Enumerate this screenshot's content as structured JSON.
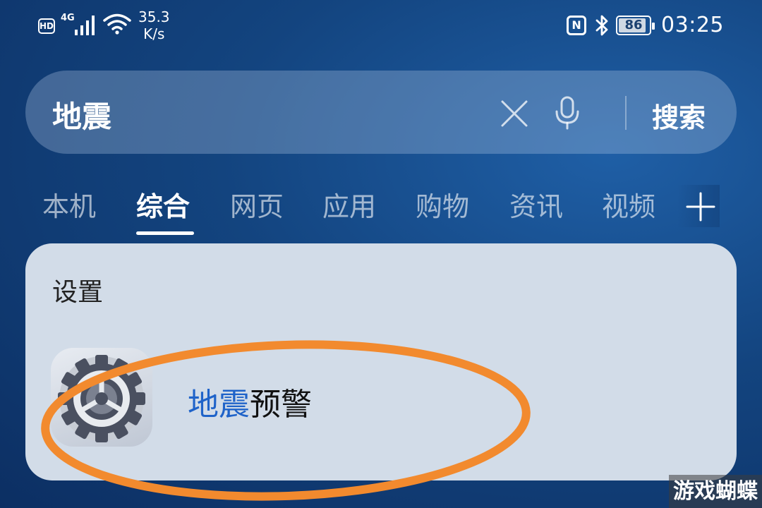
{
  "status_bar": {
    "hd_badge": "HD",
    "network": "4G",
    "net_speed_value": "35.3",
    "net_speed_unit": "K/s",
    "nfc_badge": "N",
    "battery_level": "86",
    "time": "03:25"
  },
  "search": {
    "query": "地震",
    "button_label": "搜索",
    "icons": [
      "close-icon",
      "microphone-icon"
    ]
  },
  "tabs": [
    {
      "label": "本机",
      "active": false
    },
    {
      "label": "综合",
      "active": true
    },
    {
      "label": "网页",
      "active": false
    },
    {
      "label": "应用",
      "active": false
    },
    {
      "label": "购物",
      "active": false
    },
    {
      "label": "资讯",
      "active": false
    },
    {
      "label": "视频",
      "active": false
    }
  ],
  "result_card": {
    "section_title": "设置",
    "item": {
      "highlight": "地震",
      "rest": "预警",
      "icon": "settings-gear-icon"
    }
  },
  "colors": {
    "highlight": "#1f63c9",
    "annotation_ring": "#f28a2e"
  },
  "watermark": "游戏蝴蝶"
}
